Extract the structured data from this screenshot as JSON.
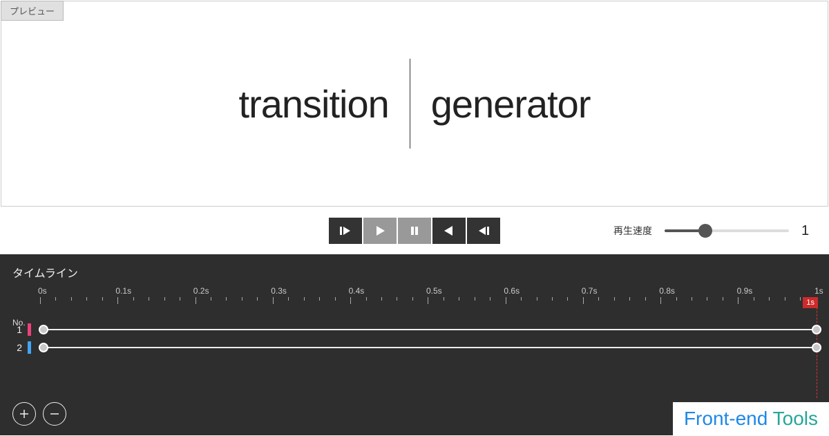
{
  "preview_tab": "プレビュー",
  "title": {
    "word1": "transition",
    "word2": "generator"
  },
  "speed": {
    "label": "再生速度",
    "value": "1"
  },
  "timeline": {
    "title": "タイムライン",
    "no_label": "No.",
    "ruler_labels": [
      "0s",
      "0.1s",
      "0.2s",
      "0.3s",
      "0.4s",
      "0.5s",
      "0.6s",
      "0.7s",
      "0.8s",
      "0.9s",
      "1s"
    ],
    "playhead_label": "1s",
    "tracks": [
      {
        "no": "1",
        "color": "#ec407a"
      },
      {
        "no": "2",
        "color": "#42a5f5"
      }
    ]
  },
  "brand": {
    "part1": "Front-end",
    "part2": "Tools"
  }
}
